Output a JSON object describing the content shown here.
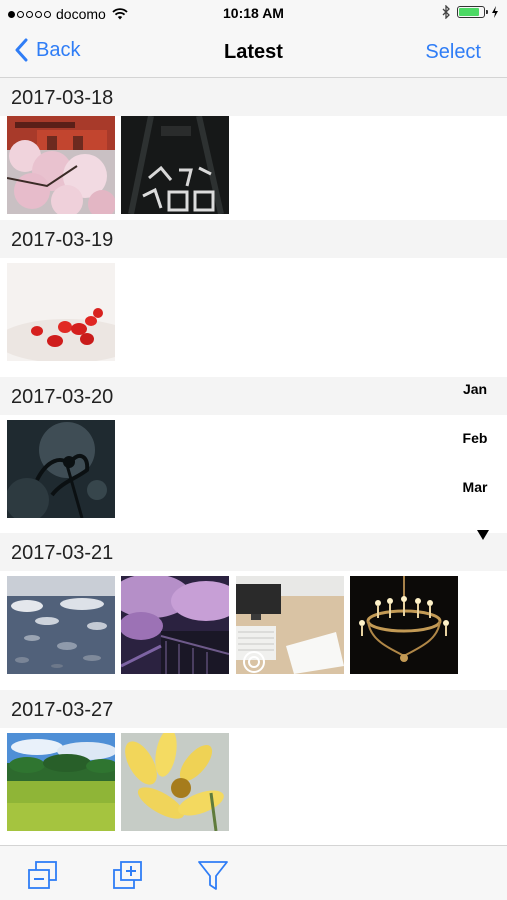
{
  "status_bar": {
    "carrier": "docomo",
    "time": "10:18 AM",
    "signal_bars_filled": 1,
    "signal_bars_total": 5,
    "battery_level": 0.76,
    "battery_color": "#4cd964"
  },
  "nav": {
    "back_label": "Back",
    "title": "Latest",
    "select_label": "Select",
    "accent_color": "#2f7df6"
  },
  "sections": [
    {
      "date": "2017-03-18",
      "photos": [
        "cherry-blossom-temple",
        "school-road-marking-night"
      ]
    },
    {
      "date": "2017-03-19",
      "photos": [
        "strawberries-cream"
      ]
    },
    {
      "date": "2017-03-20",
      "photos": [
        "dark-flower-silhouette"
      ]
    },
    {
      "date": "2017-03-21",
      "photos": [
        "river-stones",
        "night-cherry-blossoms",
        "desk-keyboard",
        "chandelier"
      ]
    },
    {
      "date": "2017-03-27",
      "photos": [
        "green-field-sky",
        "yellow-daisies"
      ]
    }
  ],
  "month_index": {
    "months": [
      "Jan",
      "Feb",
      "Mar"
    ],
    "more_icon": "down-triangle-icon"
  },
  "toolbar": {
    "icons": [
      "collapse-icon",
      "expand-add-icon",
      "filter-icon"
    ]
  }
}
